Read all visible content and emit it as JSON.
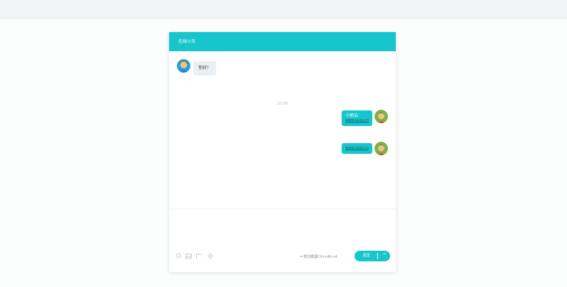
{
  "header": {
    "title": "在线小天"
  },
  "messages": {
    "incoming": {
      "text": "你好！"
    },
    "timestamp": "20:59",
    "outgoing": [
      {
        "name": "小丽云",
        "link": "www.xxxx.cn"
      },
      {
        "link": "www.xxxx.cn"
      }
    ]
  },
  "toolbar": {
    "icons": [
      "emoji-icon",
      "image-icon",
      "folder-icon",
      "sound-icon"
    ],
    "screenshot_label": "按住截图Ctrl+Alt+A",
    "send_label": "发送",
    "send_menu_icon": "chevron-up-icon"
  },
  "colors": {
    "accent": "#17c6cc",
    "bubble_incoming": "#eceff1"
  }
}
